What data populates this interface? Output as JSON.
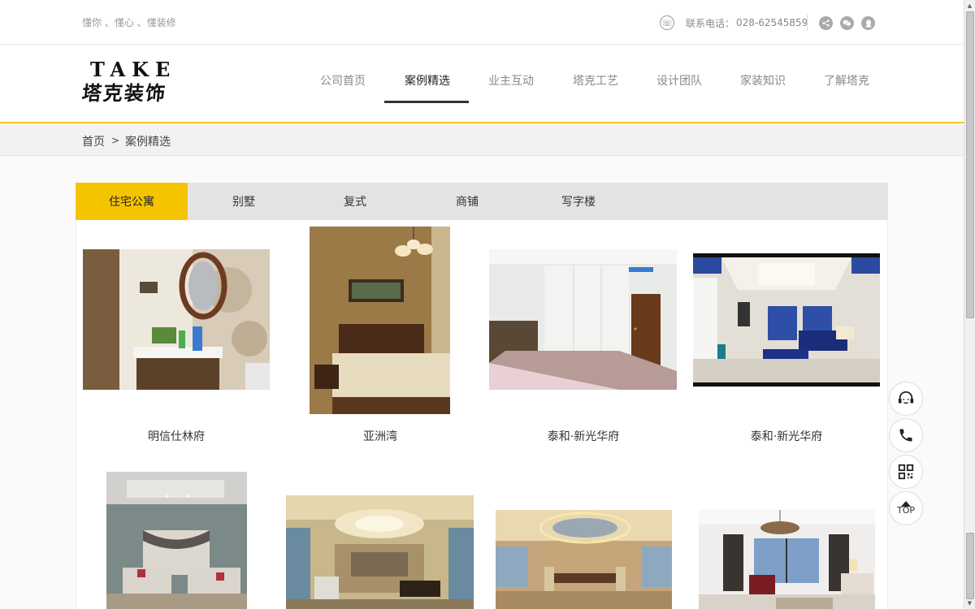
{
  "topbar": {
    "slogan": "懂你 、懂心 、懂装修",
    "phone_label": "联系电话：",
    "phone_number": "028-62545859",
    "social_icons": [
      "share-icon",
      "wechat-icon",
      "qq-icon"
    ]
  },
  "header": {
    "logo_en": "TAKE",
    "logo_cn": "塔克装饰",
    "nav": [
      {
        "label": "公司首页",
        "active": false
      },
      {
        "label": "案例精选",
        "active": true
      },
      {
        "label": "业主互动",
        "active": false
      },
      {
        "label": "塔克工艺",
        "active": false
      },
      {
        "label": "设计团队",
        "active": false
      },
      {
        "label": "家装知识",
        "active": false
      },
      {
        "label": "了解塔克",
        "active": false
      }
    ]
  },
  "breadcrumb": {
    "home": "首页",
    "separator": ">",
    "current": "案例精选"
  },
  "tabs": [
    {
      "label": "住宅公寓",
      "active": true
    },
    {
      "label": "别墅",
      "active": false
    },
    {
      "label": "复式",
      "active": false
    },
    {
      "label": "商铺",
      "active": false
    },
    {
      "label": "写字楼",
      "active": false
    }
  ],
  "cases": [
    {
      "title": "明信仕林府"
    },
    {
      "title": "亚洲湾"
    },
    {
      "title": "泰和·新光华府"
    },
    {
      "title": "泰和·新光华府"
    },
    {
      "title": ""
    },
    {
      "title": ""
    },
    {
      "title": ""
    },
    {
      "title": ""
    }
  ],
  "float_tools": {
    "top_label": "TOP"
  },
  "colors": {
    "accent": "#f5c400",
    "tab_bg": "#e3e3e3",
    "nav_text": "#888888"
  }
}
